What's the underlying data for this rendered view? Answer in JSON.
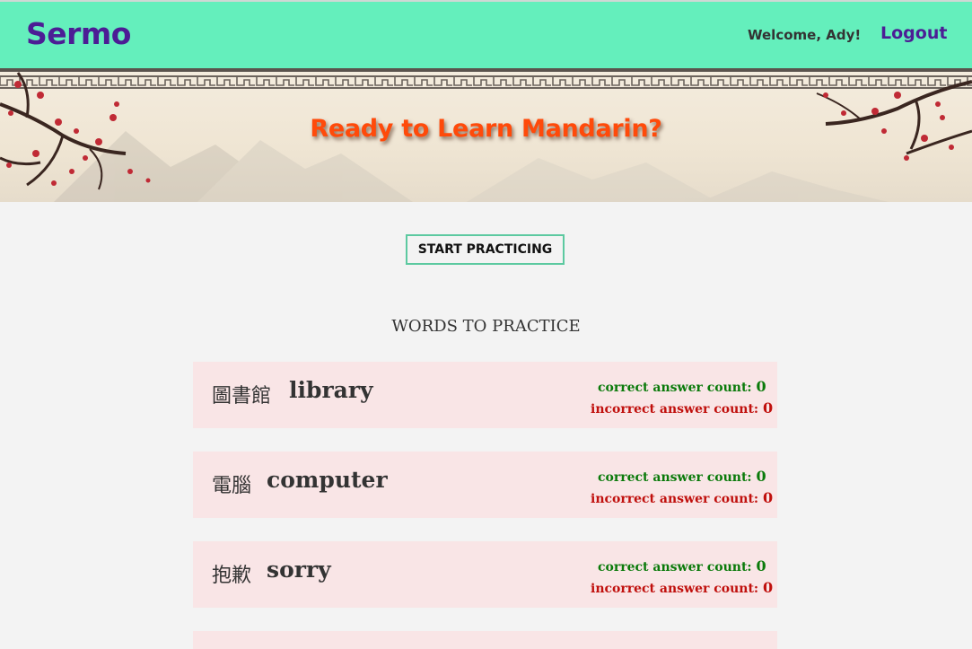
{
  "header": {
    "brand": "Sermo",
    "welcome": "Welcome, Ady!",
    "logout_label": "Logout"
  },
  "banner": {
    "title": "Ready to Learn Mandarin?"
  },
  "main": {
    "start_button_label": "START PRACTICING",
    "section_title": "WORDS TO PRACTICE",
    "correct_label": "correct answer count:",
    "incorrect_label": "incorrect answer count:",
    "words": [
      {
        "hanzi": "圖書館",
        "english": "library",
        "correct": "0",
        "incorrect": "0"
      },
      {
        "hanzi": "電腦",
        "english": "computer",
        "correct": "0",
        "incorrect": "0"
      },
      {
        "hanzi": "抱歉",
        "english": "sorry",
        "correct": "0",
        "incorrect": "0"
      },
      {
        "hanzi": "",
        "english": "",
        "correct": "",
        "incorrect": ""
      }
    ]
  },
  "colors": {
    "header_bg": "#64efbc",
    "brand": "#4c1d95",
    "banner_title": "#ff4a0a",
    "card_bg": "#f9e5e6",
    "correct": "#0a7a0a",
    "incorrect": "#c0100d"
  },
  "icons": [
    "cherry-blossom-branch",
    "fretwork-border",
    "mountain-landscape"
  ]
}
